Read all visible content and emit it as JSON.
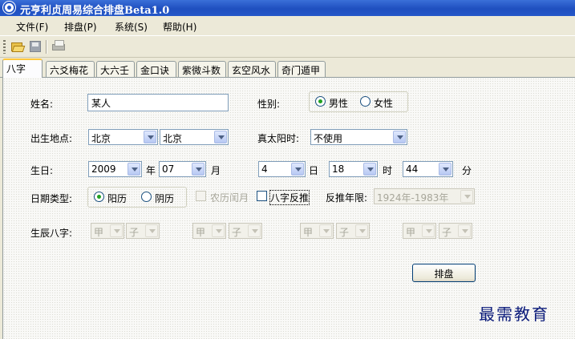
{
  "window": {
    "title": "元亨利贞周易综合排盘Beta1.0"
  },
  "menu": {
    "items": [
      "文件(F)",
      "排盘(P)",
      "系统(S)",
      "帮助(H)"
    ]
  },
  "toolbar": {
    "buttons": [
      "open-folder-icon",
      "save-disk-icon",
      "printer-icon"
    ]
  },
  "tabs": [
    "八字",
    "六爻梅花",
    "大六壬",
    "金口诀",
    "紫微斗数",
    "玄空风水",
    "奇门遁甲"
  ],
  "form": {
    "name_label": "姓名:",
    "name_value": "某人",
    "gender_label": "性别:",
    "gender_options": [
      "男性",
      "女性"
    ],
    "gender_selected": "男性",
    "birthplace_label": "出生地点:",
    "province": "北京",
    "city": "北京",
    "solar_time_label": "真太阳时:",
    "solar_time_value": "不使用",
    "birth_label": "生日:",
    "year_value": "2009",
    "year_unit": "年",
    "month_value": "07",
    "month_unit": "月",
    "day_value": "4",
    "day_unit": "日",
    "hour_value": "18",
    "hour_unit": "时",
    "minute_value": "44",
    "minute_unit": "分",
    "date_type_label": "日期类型:",
    "date_type_options": [
      "阳历",
      "阴历"
    ],
    "date_type_selected": "阳历",
    "leap_month_label": "农历闰月",
    "reverse_bazi_label": "八字反推",
    "reverse_range_label": "反推年限:",
    "reverse_range_value": "1924年-1983年",
    "bazi_label": "生辰八字:",
    "pillars": [
      {
        "stem": "甲",
        "branch": "子"
      },
      {
        "stem": "甲",
        "branch": "子"
      },
      {
        "stem": "甲",
        "branch": "子"
      },
      {
        "stem": "甲",
        "branch": "子"
      }
    ],
    "submit_label": "排盘"
  },
  "watermark": "最需教育",
  "colors": {
    "titlebar": "#2457c8",
    "radio_dot": "#21a121",
    "watermark": "#0a1a7a",
    "tab_highlight": "#ffc83c"
  }
}
